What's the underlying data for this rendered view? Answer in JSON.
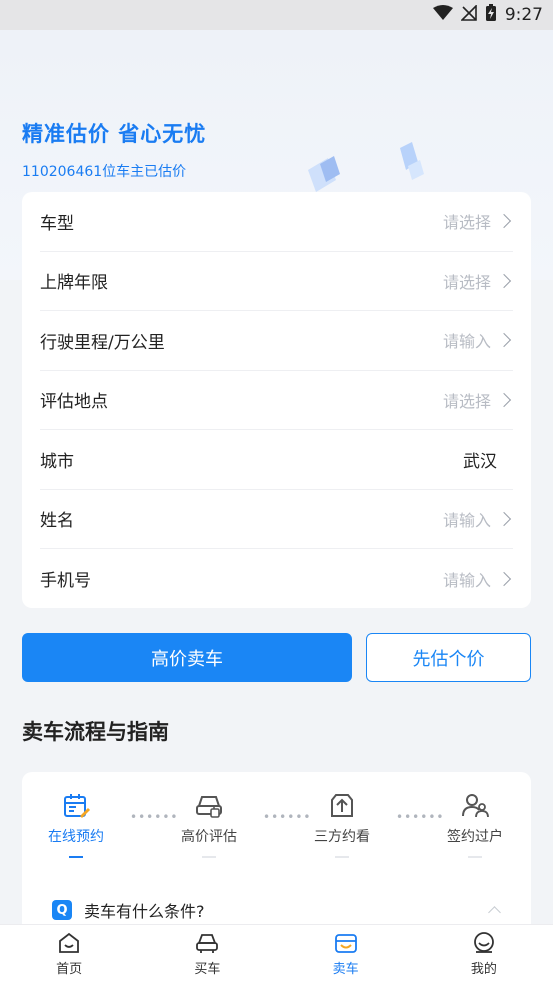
{
  "status_bar": {
    "time": "9:27"
  },
  "hero": {
    "title": "精准估价 省心无忧",
    "subtitle": "110206461位车主已估价"
  },
  "form": {
    "rows": [
      {
        "label": "车型",
        "value": "请选择",
        "filled": false
      },
      {
        "label": "上牌年限",
        "value": "请选择",
        "filled": false
      },
      {
        "label": "行驶里程/万公里",
        "value": "请输入",
        "filled": false
      },
      {
        "label": "评估地点",
        "value": "请选择",
        "filled": false
      },
      {
        "label": "城市",
        "value": "武汉",
        "filled": true
      },
      {
        "label": "姓名",
        "value": "请输入",
        "filled": false
      },
      {
        "label": "手机号",
        "value": "请输入",
        "filled": false
      }
    ]
  },
  "actions": {
    "primary_label": "高价卖车",
    "secondary_label": "先估个价"
  },
  "guide": {
    "title": "卖车流程与指南",
    "steps": [
      {
        "label": "在线预约",
        "icon": "calendar-edit-icon",
        "active": true
      },
      {
        "label": "高价评估",
        "icon": "car-appraisal-icon",
        "active": false
      },
      {
        "label": "三方约看",
        "icon": "upload-box-icon",
        "active": false
      },
      {
        "label": "签约过户",
        "icon": "users-icon",
        "active": false
      }
    ],
    "faq": {
      "badge": "Q",
      "question": "卖车有什么条件?"
    }
  },
  "bottom_nav": [
    {
      "label": "首页",
      "icon": "home-icon",
      "active": false
    },
    {
      "label": "买车",
      "icon": "car-icon",
      "active": false
    },
    {
      "label": "卖车",
      "icon": "sell-car-icon",
      "active": true
    },
    {
      "label": "我的",
      "icon": "profile-icon",
      "active": false
    }
  ],
  "colors": {
    "accent": "#1a86f5",
    "text": "#222222",
    "placeholder": "#b8bcc4",
    "background": "#f2f4f7"
  }
}
